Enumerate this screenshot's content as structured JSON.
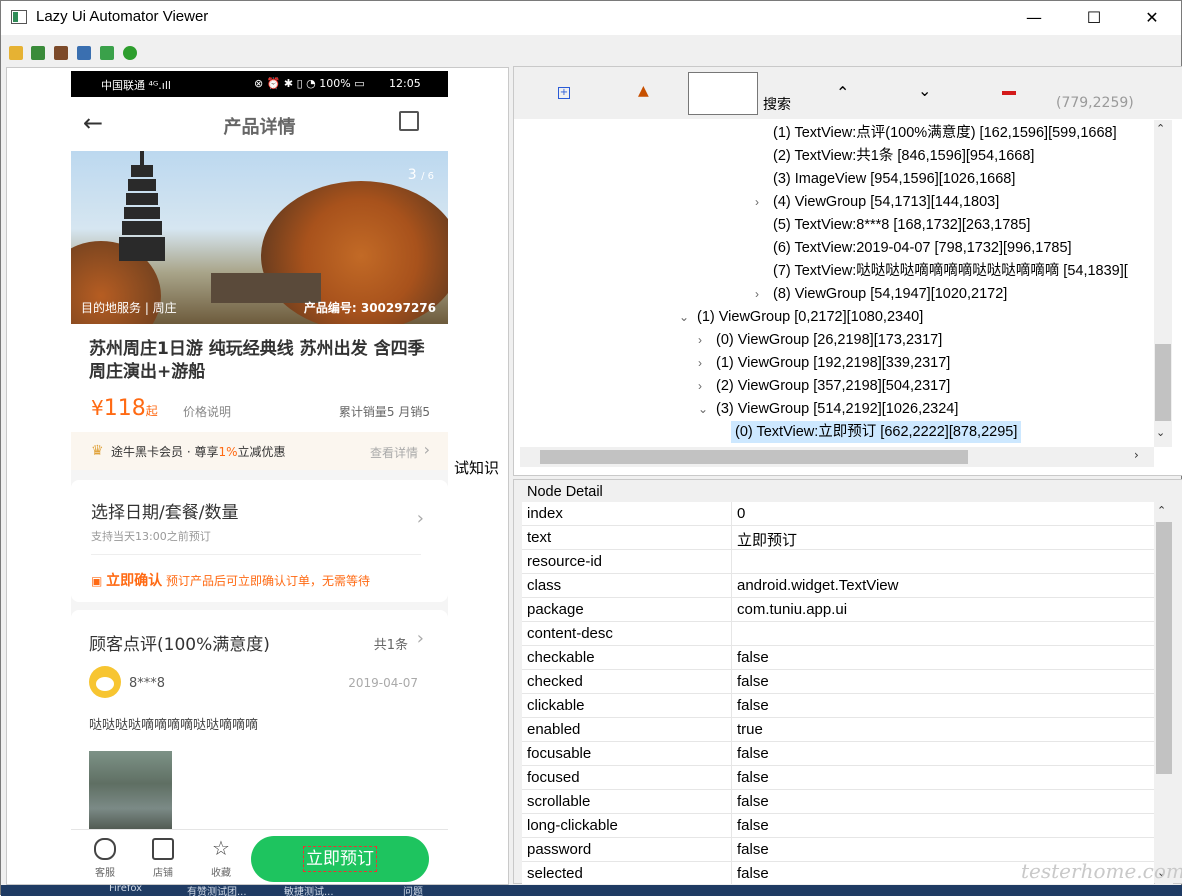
{
  "window": {
    "title": "Lazy Ui Automator Viewer",
    "minimize": "—",
    "maximize": "☐",
    "close": "✕"
  },
  "toolbar": {
    "icons": [
      "open-folder-icon",
      "screenshot-device-icon",
      "screenshot-compressed-icon",
      "save-icon",
      "export-icon",
      "globe-icon"
    ],
    "colors": [
      "#e6b233",
      "#3a8b3a",
      "#7c4a2a",
      "#3a6fb0",
      "#3aa14a",
      "#2e9e2e"
    ]
  },
  "phone": {
    "status": {
      "carrier": "中国联通 ⁴ᴳ.ıll",
      "icons": "⊗ ⏰ ✱ ▯ ◔ 100% ▭",
      "time": "12:05"
    },
    "nav_title": "产品详情",
    "banner": {
      "counter": "3",
      "counter_total": "/ 6",
      "destination": "目的地服务 | 周庄",
      "product_no": "产品编号: 300297276"
    },
    "product_title": "苏州周庄1日游 纯玩经典线 苏州出发 含四季周庄演出+游船",
    "price_currency": "¥",
    "price_value": "118",
    "price_suffix": "起",
    "price_explain": "价格说明",
    "sales": "累计销量5   月销5",
    "vip_text_a": "途牛黑卡会员 · 尊享",
    "vip_pct": "1%",
    "vip_text_b": "立减优惠",
    "vip_more": "查看详情",
    "date_title": "选择日期/套餐/数量",
    "date_sub": "支持当天13:00之前预订",
    "confirm_title": "立即确认",
    "confirm_text": "预订产品后可立即确认订单，无需等待",
    "review_title": "顾客点评(100%满意度)",
    "review_count": "共1条",
    "review_user": "8***8",
    "review_date": "2019-04-07",
    "review_comment": "哒哒哒哒嘀嘀嘀嘀哒哒嘀嘀嘀",
    "bottom": {
      "service": "客服",
      "shop": "店铺",
      "fav": "收藏",
      "book": "立即预订"
    },
    "peek_text": "试知识"
  },
  "tree_toolbar": {
    "search_label": "搜索",
    "coords": "(779,2259)"
  },
  "tree_nodes": [
    {
      "text": "(1) TextView:点评(100%满意度) [162,1596][599,1668]",
      "arrow": ""
    },
    {
      "text": "(2) TextView:共1条 [846,1596][954,1668]",
      "arrow": ""
    },
    {
      "text": "(3) ImageView [954,1596][1026,1668]",
      "arrow": ""
    },
    {
      "text": "(4) ViewGroup [54,1713][144,1803]",
      "arrow": "›"
    },
    {
      "text": "(5) TextView:8***8 [168,1732][263,1785]",
      "arrow": ""
    },
    {
      "text": "(6) TextView:2019-04-07 [798,1732][996,1785]",
      "arrow": ""
    },
    {
      "text": "(7) TextView:哒哒哒哒嘀嘀嘀嘀哒哒哒嘀嘀嘀 [54,1839][",
      "arrow": ""
    },
    {
      "text": "(8) ViewGroup [54,1947][1020,2172]",
      "arrow": "›"
    },
    {
      "text": "(1) ViewGroup [0,2172][1080,2340]",
      "arrow": "⌄"
    },
    {
      "text": "(0) ViewGroup [26,2198][173,2317]",
      "arrow": "›"
    },
    {
      "text": "(1) ViewGroup [192,2198][339,2317]",
      "arrow": "›"
    },
    {
      "text": "(2) ViewGroup [357,2198][504,2317]",
      "arrow": "›"
    },
    {
      "text": "(3) ViewGroup [514,2192][1026,2324]",
      "arrow": "⌄"
    },
    {
      "text": "(0) TextView:立即预订 [662,2222][878,2295]",
      "arrow": ""
    }
  ],
  "detail": {
    "header": "Node Detail",
    "rows": [
      {
        "k": "index",
        "v": "0"
      },
      {
        "k": "text",
        "v": "立即预订"
      },
      {
        "k": "resource-id",
        "v": ""
      },
      {
        "k": "class",
        "v": "android.widget.TextView"
      },
      {
        "k": "package",
        "v": "com.tuniu.app.ui"
      },
      {
        "k": "content-desc",
        "v": ""
      },
      {
        "k": "checkable",
        "v": "false"
      },
      {
        "k": "checked",
        "v": "false"
      },
      {
        "k": "clickable",
        "v": "false"
      },
      {
        "k": "enabled",
        "v": "true"
      },
      {
        "k": "focusable",
        "v": "false"
      },
      {
        "k": "focused",
        "v": "false"
      },
      {
        "k": "scrollable",
        "v": "false"
      },
      {
        "k": "long-clickable",
        "v": "false"
      },
      {
        "k": "password",
        "v": "false"
      },
      {
        "k": "selected",
        "v": "false"
      }
    ]
  },
  "watermark": "testerhome.com",
  "taskbar": [
    "Firefox",
    "有赞测试团...",
    "敏捷测试...",
    "问题"
  ]
}
